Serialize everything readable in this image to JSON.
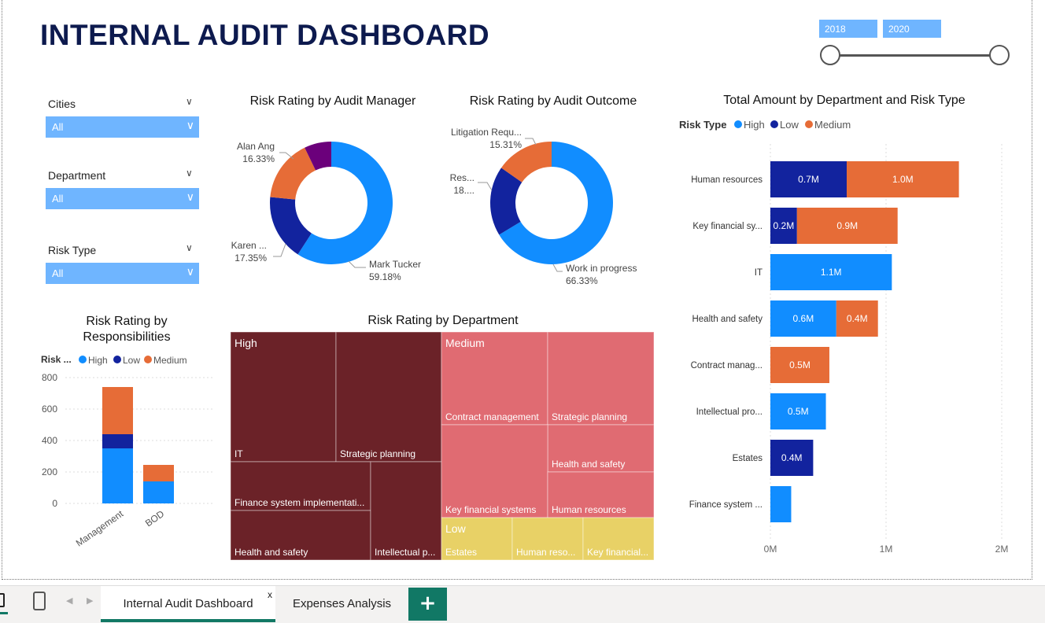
{
  "header": {
    "title": "INTERNAL AUDIT DASHBOARD"
  },
  "year_slider": {
    "start": "2018",
    "end": "2020"
  },
  "slicers": [
    {
      "label": "Cities",
      "value": "All"
    },
    {
      "label": "Department",
      "value": "All"
    },
    {
      "label": "Risk Type",
      "value": "All"
    }
  ],
  "colors": {
    "high": "#118dff",
    "low": "#12239e",
    "medium": "#e66c37",
    "purple": "#6b007b",
    "treemap_high": "#6b2228",
    "treemap_medium": "#e06b72",
    "treemap_low": "#e8d166",
    "accent": "#117865"
  },
  "legend": {
    "high": "High",
    "low": "Low",
    "medium": "Medium",
    "risk_type_label": "Risk Type",
    "risk_short": "Risk ..."
  },
  "chart_data": [
    {
      "id": "manager",
      "type": "pie",
      "title": "Risk Rating by Audit Manager",
      "slices": [
        {
          "label": "Mark Tucker",
          "percent": "59.18%",
          "value": 59.18,
          "color": "#118dff"
        },
        {
          "label": "Karen ...",
          "percent": "17.35%",
          "value": 17.35,
          "color": "#12239e"
        },
        {
          "label": "Alan Ang",
          "percent": "16.33%",
          "value": 16.33,
          "color": "#e66c37"
        },
        {
          "label": "",
          "percent": "",
          "value": 7.14,
          "color": "#6b007b"
        }
      ]
    },
    {
      "id": "outcome",
      "type": "pie",
      "title": "Risk Rating by Audit Outcome",
      "slices": [
        {
          "label": "Work in progress",
          "percent": "66.33%",
          "value": 66.33,
          "color": "#118dff"
        },
        {
          "label": "Res...",
          "percent": "18....",
          "value": 18.36,
          "color": "#12239e"
        },
        {
          "label": "Litigation Requ...",
          "percent": "15.31%",
          "value": 15.31,
          "color": "#e66c37"
        }
      ]
    },
    {
      "id": "department_amount",
      "type": "bar",
      "orientation": "horizontal",
      "title": "Total Amount by Department and Risk Type",
      "categories": [
        "Human resources",
        "Key financial sy...",
        "IT",
        "Health and safety",
        "Contract manag...",
        "Intellectual pro...",
        "Estates",
        "Finance system ..."
      ],
      "series": [
        {
          "name": "Low",
          "color": "#12239e",
          "values": [
            0.66,
            0.23,
            0,
            0,
            0,
            0,
            0.37,
            0
          ],
          "labels": [
            "0.7M",
            "0.2M",
            "",
            "",
            "",
            "",
            "0.4M",
            ""
          ]
        },
        {
          "name": "High",
          "color": "#118dff",
          "values": [
            0,
            0,
            1.05,
            0.57,
            0,
            0.48,
            0,
            0.18
          ],
          "labels": [
            "",
            "",
            "1.1M",
            "0.6M",
            "",
            "0.5M",
            "",
            ""
          ]
        },
        {
          "name": "Medium",
          "color": "#e66c37",
          "values": [
            0.97,
            0.87,
            0,
            0.36,
            0.51,
            0,
            0,
            0
          ],
          "labels": [
            "1.0M",
            "0.9M",
            "",
            "0.4M",
            "0.5M",
            "",
            "",
            ""
          ]
        }
      ],
      "xticks": [
        "0M",
        "1M",
        "2M"
      ],
      "xlim": [
        0,
        2
      ]
    },
    {
      "id": "responsibilities",
      "type": "bar",
      "orientation": "vertical",
      "title": "Risk Rating by Responsibilities",
      "categories": [
        "Management",
        "BOD"
      ],
      "series": [
        {
          "name": "High",
          "color": "#118dff",
          "values": [
            350,
            140
          ]
        },
        {
          "name": "Low",
          "color": "#12239e",
          "values": [
            90,
            0
          ]
        },
        {
          "name": "Medium",
          "color": "#e66c37",
          "values": [
            300,
            105
          ]
        }
      ],
      "yticks": [
        "800",
        "600",
        "400",
        "200",
        "0"
      ],
      "ylim": [
        0,
        800
      ]
    },
    {
      "id": "treemap",
      "type": "treemap",
      "title": "Risk Rating by Department",
      "groups": [
        {
          "name": "High",
          "items": [
            "IT",
            "Strategic planning",
            "Finance system implementati...",
            "Health and safety",
            "Intellectual p..."
          ]
        },
        {
          "name": "Medium",
          "items": [
            "Contract management",
            "Strategic planning",
            "Health and safety",
            "Key financial systems",
            "Human resources"
          ]
        },
        {
          "name": "Low",
          "items": [
            "Estates",
            "Human reso...",
            "Key financial..."
          ]
        }
      ]
    }
  ],
  "tabs": [
    {
      "label": "Internal Audit Dashboard",
      "close": "x"
    },
    {
      "label": "Expenses Analysis"
    },
    {
      "label": "+"
    }
  ]
}
